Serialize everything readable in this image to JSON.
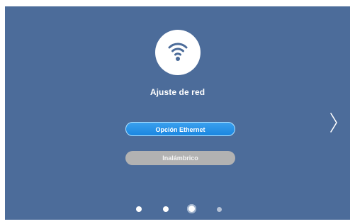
{
  "settings_page": {
    "title": "Ajuste de red",
    "icon": "wifi-icon",
    "options": [
      {
        "label": "Opción Ethernet",
        "state": "selected"
      },
      {
        "label": "Inalámbrico",
        "state": "unselected"
      }
    ]
  },
  "navigation": {
    "next_icon": "chevron-right-icon",
    "pagination": {
      "total": 4,
      "current": 3
    }
  },
  "colors": {
    "background": "#4c6c9a",
    "selected_button": "#1b86e0",
    "unselected_button": "#b2b2b2"
  }
}
